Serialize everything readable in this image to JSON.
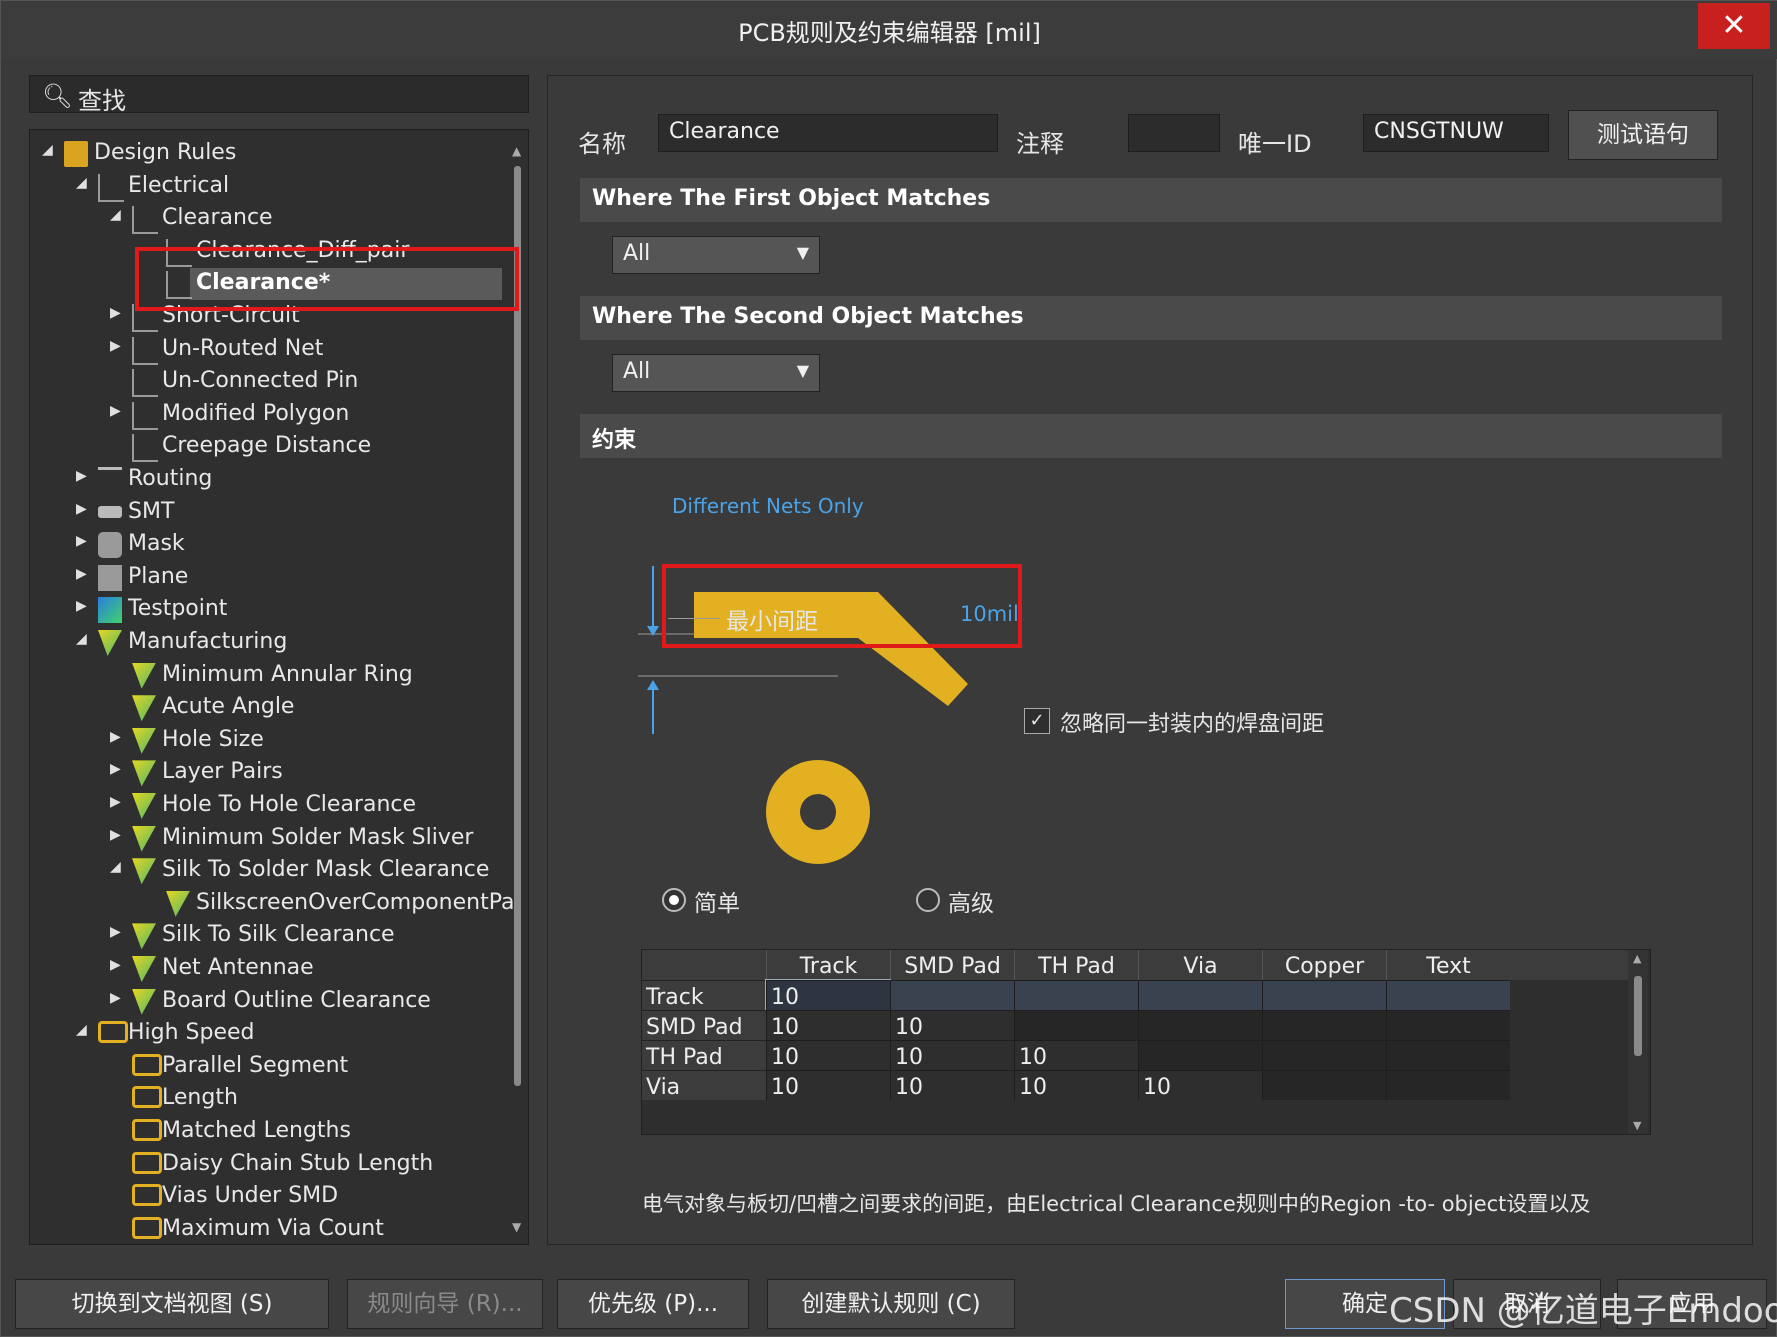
{
  "window": {
    "title": "PCB规则及约束编辑器 [mil]",
    "close_label": "✕"
  },
  "search": {
    "placeholder": "查找"
  },
  "tree": [
    {
      "label": "Design Rules",
      "arrow": "◢",
      "icon": "folder-rules-icon"
    },
    {
      "label": "Electrical",
      "arrow": "◢",
      "icon": "electrical-icon"
    },
    {
      "label": "Clearance",
      "arrow": "◢",
      "icon": "electrical-icon"
    },
    {
      "label": "Clearance_Diff_pair",
      "arrow": "",
      "icon": "electrical-icon"
    },
    {
      "label": "Clearance*",
      "arrow": "",
      "icon": "electrical-icon",
      "selected": true
    },
    {
      "label": "Short-Circuit",
      "arrow": "▶",
      "icon": "electrical-icon"
    },
    {
      "label": "Un-Routed Net",
      "arrow": "▶",
      "icon": "electrical-icon"
    },
    {
      "label": "Un-Connected Pin",
      "arrow": "",
      "icon": "electrical-icon"
    },
    {
      "label": "Modified Polygon",
      "arrow": "▶",
      "icon": "electrical-icon"
    },
    {
      "label": "Creepage Distance",
      "arrow": "",
      "icon": "electrical-icon"
    },
    {
      "label": "Routing",
      "arrow": "▶",
      "icon": "routing-icon"
    },
    {
      "label": "SMT",
      "arrow": "▶",
      "icon": "smt-icon"
    },
    {
      "label": "Mask",
      "arrow": "▶",
      "icon": "mask-icon"
    },
    {
      "label": "Plane",
      "arrow": "▶",
      "icon": "plane-icon"
    },
    {
      "label": "Testpoint",
      "arrow": "▶",
      "icon": "testpoint-icon"
    },
    {
      "label": "Manufacturing",
      "arrow": "◢",
      "icon": "manufacturing-icon"
    },
    {
      "label": "Minimum Annular Ring",
      "arrow": "",
      "icon": "manufacturing-icon"
    },
    {
      "label": "Acute Angle",
      "arrow": "",
      "icon": "manufacturing-icon"
    },
    {
      "label": "Hole Size",
      "arrow": "▶",
      "icon": "manufacturing-icon"
    },
    {
      "label": "Layer Pairs",
      "arrow": "▶",
      "icon": "manufacturing-icon"
    },
    {
      "label": "Hole To Hole Clearance",
      "arrow": "▶",
      "icon": "manufacturing-icon"
    },
    {
      "label": "Minimum Solder Mask Sliver",
      "arrow": "▶",
      "icon": "manufacturing-icon"
    },
    {
      "label": "Silk To Solder Mask Clearance",
      "arrow": "◢",
      "icon": "manufacturing-icon"
    },
    {
      "label": "SilkscreenOverComponentPa",
      "arrow": "",
      "icon": "manufacturing-icon"
    },
    {
      "label": "Silk To Silk Clearance",
      "arrow": "▶",
      "icon": "manufacturing-icon"
    },
    {
      "label": "Net Antennae",
      "arrow": "▶",
      "icon": "manufacturing-icon"
    },
    {
      "label": "Board Outline Clearance",
      "arrow": "▶",
      "icon": "manufacturing-icon"
    },
    {
      "label": "High Speed",
      "arrow": "◢",
      "icon": "highspeed-icon"
    },
    {
      "label": "Parallel Segment",
      "arrow": "",
      "icon": "highspeed-icon"
    },
    {
      "label": "Length",
      "arrow": "",
      "icon": "highspeed-icon"
    },
    {
      "label": "Matched Lengths",
      "arrow": "",
      "icon": "highspeed-icon"
    },
    {
      "label": "Daisy Chain Stub Length",
      "arrow": "",
      "icon": "highspeed-icon"
    },
    {
      "label": "Vias Under SMD",
      "arrow": "",
      "icon": "highspeed-icon"
    },
    {
      "label": "Maximum Via Count",
      "arrow": "",
      "icon": "highspeed-icon"
    }
  ],
  "rule": {
    "name_label": "名称",
    "name_value": "Clearance",
    "comment_label": "注释",
    "comment_value": "",
    "id_label": "唯一ID",
    "id_value": "CNSGTNUW",
    "test_button": "测试语句"
  },
  "first_match": {
    "title": "Where The First Object Matches",
    "value": "All"
  },
  "second_match": {
    "title": "Where The Second Object Matches",
    "value": "All"
  },
  "constraints": {
    "title": "约束",
    "diff_nets": "Different Nets Only",
    "min_clearance_label": "最小间距",
    "min_clearance_value": "10mil",
    "ignore_pads_label": "忽略同一封装内的焊盘间距",
    "ignore_pads_checked": true,
    "mode_simple": "简单",
    "mode_advanced": "高级",
    "mode_selected": "简单"
  },
  "matrix": {
    "columns": [
      "Track",
      "SMD Pad",
      "TH Pad",
      "Via",
      "Copper",
      "Text"
    ],
    "rows": [
      {
        "name": "Track",
        "values": [
          "10",
          "",
          "",
          "",
          "",
          ""
        ]
      },
      {
        "name": "SMD Pad",
        "values": [
          "10",
          "10",
          "",
          "",
          "",
          ""
        ]
      },
      {
        "name": "TH Pad",
        "values": [
          "10",
          "10",
          "10",
          "",
          "",
          ""
        ]
      },
      {
        "name": "Via",
        "values": [
          "10",
          "10",
          "10",
          "10",
          "",
          ""
        ]
      }
    ]
  },
  "description": "电气对象与板切/凹槽之间要求的间距，由Electrical Clearance规则中的Region -to- object设置以及",
  "footer": {
    "doc_view": "切换到文档视图 (S)",
    "wizard": "规则向导 (R)...",
    "priority": "优先级 (P)...",
    "create_default": "创建默认规则 (C)",
    "ok": "确定",
    "cancel": "取消",
    "apply": "应用"
  },
  "watermark": "CSDN @亿道电子Emdoor",
  "colors": {
    "accent_red": "#e0191a",
    "copper": "#e2b020",
    "link_blue": "#4aa3e8"
  }
}
